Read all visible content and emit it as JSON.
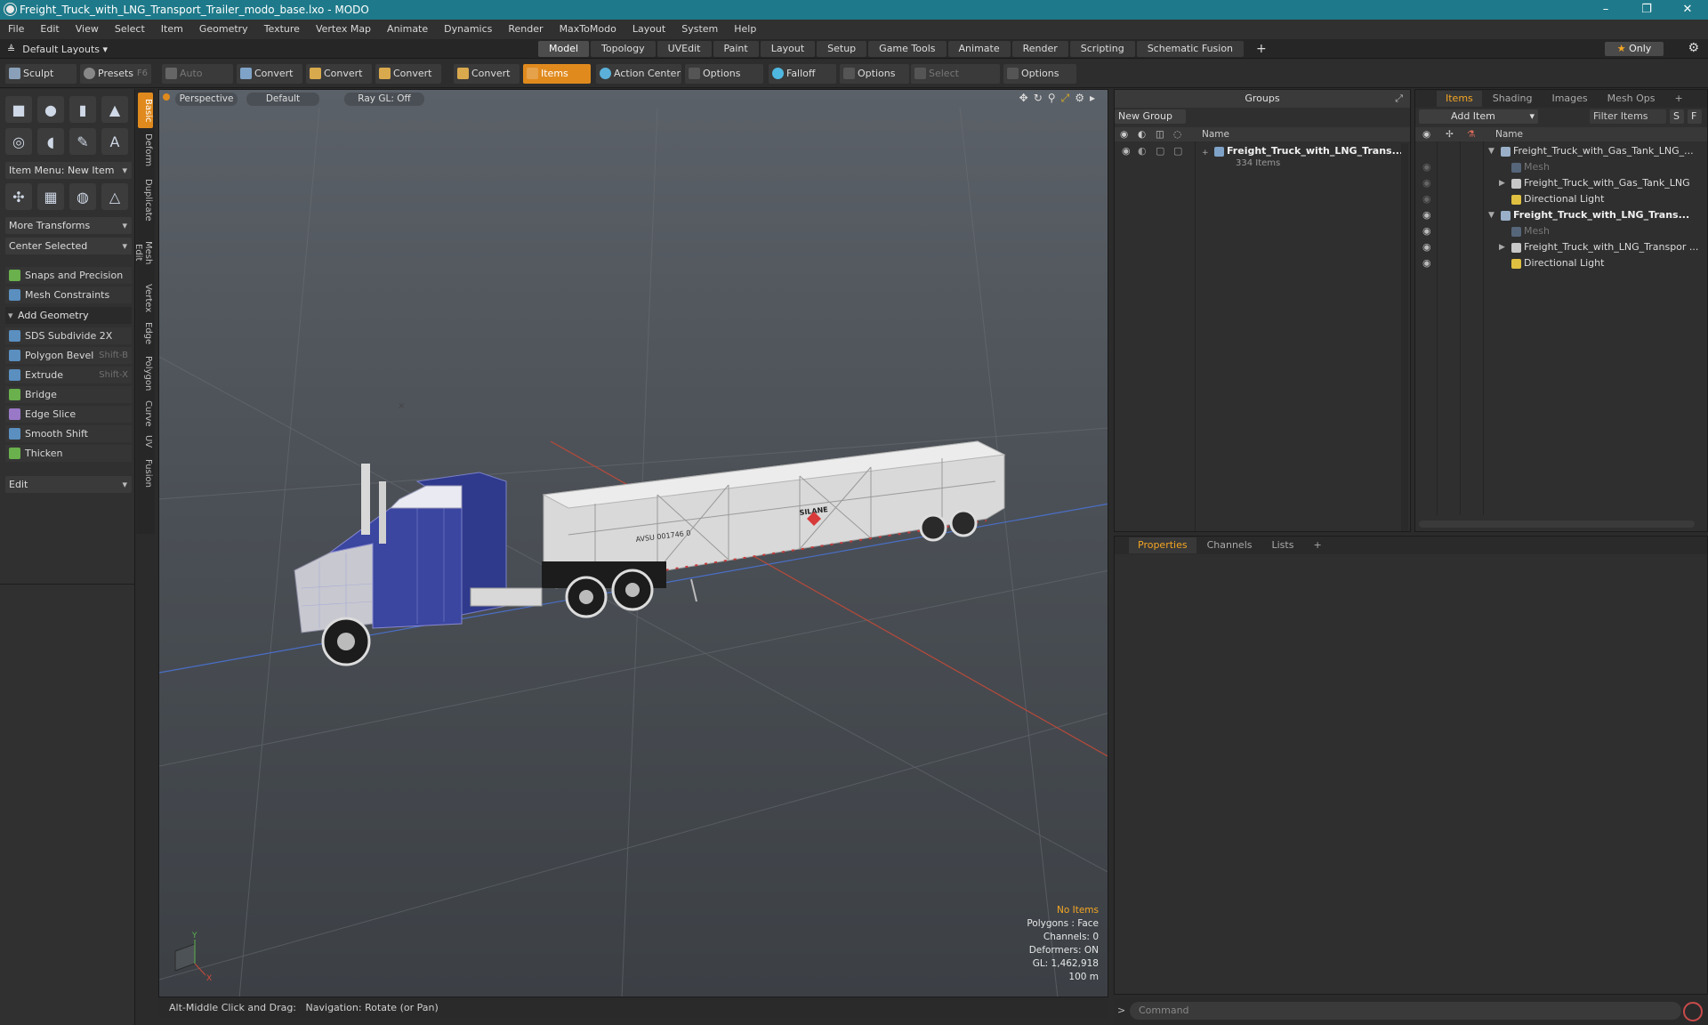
{
  "window": {
    "title": "Freight_Truck_with_LNG_Transport_Trailer_modo_base.lxo - MODO",
    "controls": [
      "–",
      "❐",
      "✕"
    ]
  },
  "menu": [
    "File",
    "Edit",
    "View",
    "Select",
    "Item",
    "Geometry",
    "Texture",
    "Vertex Map",
    "Animate",
    "Dynamics",
    "Render",
    "MaxToModo",
    "Layout",
    "System",
    "Help"
  ],
  "layoutbar": {
    "layout_label": "Default Layouts",
    "tabs": [
      "Model",
      "Topology",
      "UVEdit",
      "Paint",
      "Layout",
      "Setup",
      "Game Tools",
      "Animate",
      "Render",
      "Scripting",
      "Schematic Fusion"
    ],
    "active_tab": "Model",
    "plus": "+",
    "only_label": "Only",
    "only_star": "★"
  },
  "toolbar": {
    "sculpt": "Sculpt",
    "presets": "Presets",
    "presets_key": "F6",
    "auto_select": "Auto Select",
    "convert1": "Convert",
    "convert2": "Convert",
    "convert3": "Convert",
    "convert4": "Convert",
    "items": "Items",
    "action_center": "Action Center",
    "options1": "Options",
    "falloff": "Falloff",
    "options2": "Options",
    "select_through": "Select Through",
    "options3": "Options"
  },
  "leftpanel": {
    "item_menu": "Item Menu: New Item",
    "more_transforms": "More Transforms",
    "center_selected": "Center Selected",
    "snaps": "Snaps and Precision",
    "mesh_constraints": "Mesh Constraints",
    "add_geometry": "Add Geometry",
    "tools": [
      {
        "label": "SDS Subdivide 2X",
        "shortcut": ""
      },
      {
        "label": "Polygon Bevel",
        "shortcut": "Shift-B"
      },
      {
        "label": "Extrude",
        "shortcut": "Shift-X"
      },
      {
        "label": "Bridge",
        "shortcut": ""
      },
      {
        "label": "Edge Slice",
        "shortcut": ""
      },
      {
        "label": "Smooth Shift",
        "shortcut": ""
      },
      {
        "label": "Thicken",
        "shortcut": ""
      }
    ],
    "edit": "Edit"
  },
  "vtabs": [
    "Basic",
    "Deform",
    "Duplicate",
    "Mesh Edit",
    "Vertex",
    "Edge",
    "Polygon",
    "Curve",
    "UV",
    "Fusion"
  ],
  "viewport": {
    "view_mode": "Perspective",
    "shading": "Default",
    "raygl": "Ray GL: Off",
    "trailer_text_1": "AVSU 001746 0",
    "trailer_text_2": "SILANE",
    "stats": {
      "selection": "No Items",
      "polygons": "Polygons : Face",
      "channels": "Channels: 0",
      "deformers": "Deformers: ON",
      "gl": "GL: 1,462,918",
      "distance": "100 m"
    },
    "axis_x": "X",
    "axis_y": "Y"
  },
  "hint": {
    "action": "Alt-Middle Click and Drag:",
    "description": "Navigation: Rotate (or Pan)"
  },
  "groups": {
    "title": "Groups",
    "new_group": "New Group",
    "col_name": "Name",
    "entry_name": "Freight_Truck_with_LNG_Trans...",
    "entry_count": "334 Items"
  },
  "items_panel": {
    "tabs": [
      "Items",
      "Shading",
      "Images",
      "Mesh Ops"
    ],
    "active_tab": "Items",
    "add_item": "Add Item",
    "filter": "Filter Items",
    "s_btn": "S",
    "f_btn": "F",
    "col_name": "Name",
    "rows": [
      {
        "name": "Freight_Truck_with_Gas_Tank_LNG_...",
        "level": 0,
        "type": "scene",
        "expanded": true,
        "bold": false,
        "dim": false
      },
      {
        "name": "Mesh",
        "level": 1,
        "type": "mesh",
        "expanded": false,
        "bold": false,
        "dim": true
      },
      {
        "name": "Freight_Truck_with_Gas_Tank_LNG",
        "level": 1,
        "type": "group",
        "expanded": false,
        "bold": false,
        "dim": false
      },
      {
        "name": "Directional Light",
        "level": 1,
        "type": "light",
        "expanded": false,
        "bold": false,
        "dim": false
      },
      {
        "name": "Freight_Truck_with_LNG_Trans...",
        "level": 0,
        "type": "scene",
        "expanded": true,
        "bold": true,
        "dim": false
      },
      {
        "name": "Mesh",
        "level": 1,
        "type": "mesh",
        "expanded": false,
        "bold": false,
        "dim": true
      },
      {
        "name": "Freight_Truck_with_LNG_Transpor ...",
        "level": 1,
        "type": "group",
        "expanded": false,
        "bold": false,
        "dim": false
      },
      {
        "name": "Directional Light",
        "level": 1,
        "type": "light",
        "expanded": false,
        "bold": false,
        "dim": false
      }
    ]
  },
  "properties": {
    "tabs": [
      "Properties",
      "Channels",
      "Lists"
    ],
    "active_tab": "Properties",
    "plus": "+"
  },
  "command": {
    "placeholder": "Command",
    "prompt": ">"
  },
  "colors": {
    "accent": "#e08a1e",
    "titlebar": "#1e7a8a",
    "viewport_top": "#5b6168",
    "truck_blue": "#3a46a0"
  }
}
